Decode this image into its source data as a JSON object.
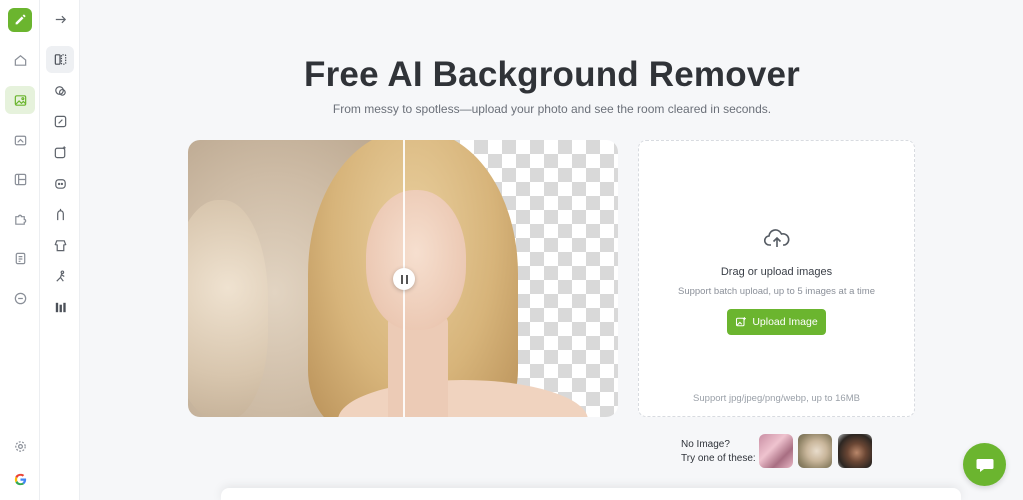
{
  "app": {
    "logo_icon": "pencil-logo-icon",
    "brand_color": "#6bb52f"
  },
  "rail": {
    "items": [
      {
        "icon": "home-icon"
      },
      {
        "icon": "image-icon",
        "active": true
      },
      {
        "icon": "image-edit-icon"
      },
      {
        "icon": "layout-icon"
      },
      {
        "icon": "puzzle-icon"
      },
      {
        "icon": "document-icon"
      },
      {
        "icon": "chat-icon"
      }
    ],
    "bottom": [
      {
        "icon": "settings-icon"
      },
      {
        "icon": "google-icon"
      }
    ]
  },
  "tools": {
    "collapse_icon": "arrow-right-icon",
    "items": [
      {
        "icon": "compare-icon",
        "active": true
      },
      {
        "icon": "magic-eraser-icon"
      },
      {
        "icon": "edit-image-icon"
      },
      {
        "icon": "image-sparkle-icon"
      },
      {
        "icon": "face-icon"
      },
      {
        "icon": "figure-icon"
      },
      {
        "icon": "shirt-icon"
      },
      {
        "icon": "pose-icon"
      },
      {
        "icon": "bars-icon"
      }
    ]
  },
  "hero": {
    "title": "Free AI Background Remover",
    "subtitle": "From messy to spotless—upload your photo and see the room cleared in seconds."
  },
  "upload": {
    "title": "Drag or upload images",
    "sub": "Support batch upload, up to 5 images at a time",
    "button": "Upload Image",
    "support": "Support jpg/jpeg/png/webp, up to 16MB"
  },
  "samples": {
    "line1": "No Image?",
    "line2": "Try one of these:"
  }
}
